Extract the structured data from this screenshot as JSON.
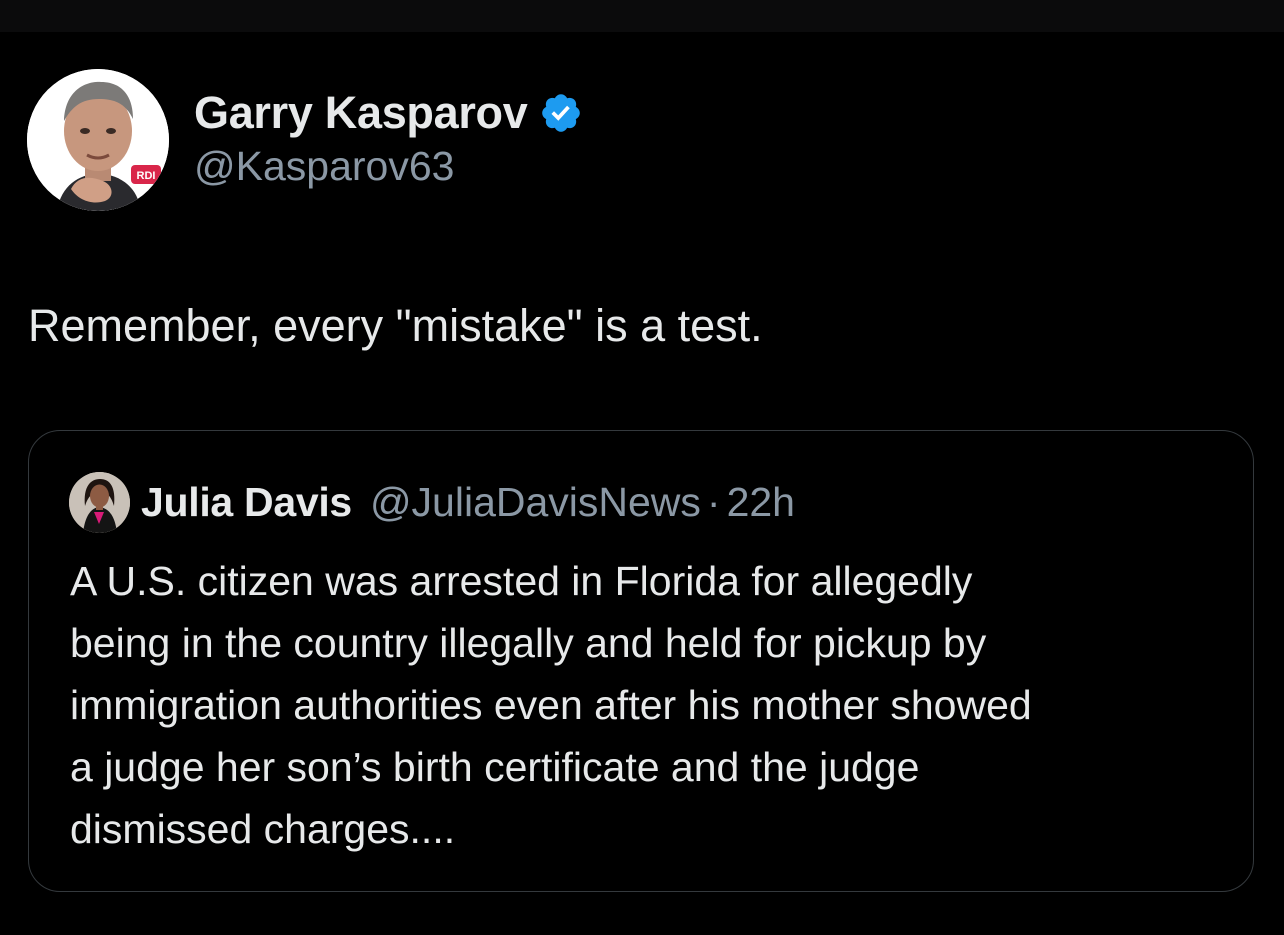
{
  "tweet": {
    "author": {
      "display_name": "Garry Kasparov",
      "handle": "@Kasparov63",
      "verified": true,
      "verified_icon": "verified-badge-icon",
      "avatar_badge_text": "RDI"
    },
    "text": "Remember, every \"mistake\" is a test."
  },
  "quoted_tweet": {
    "author": {
      "display_name": "Julia Davis",
      "handle": "@JuliaDavisNews"
    },
    "separator": "·",
    "time": "22h",
    "text": "A U.S. citizen was arrested in Florida for allegedly\nbeing in the country illegally and held for pickup by\nimmigration authorities even after his mother showed\na judge her son’s birth certificate and the judge\ndismissed charges...."
  },
  "colors": {
    "background": "#000000",
    "primary_text": "#e7e9ea",
    "secondary_text": "#8b98a5",
    "verified_blue": "#1d9bf0",
    "card_border": "#34393d",
    "avatar_badge": "#d9264a"
  }
}
